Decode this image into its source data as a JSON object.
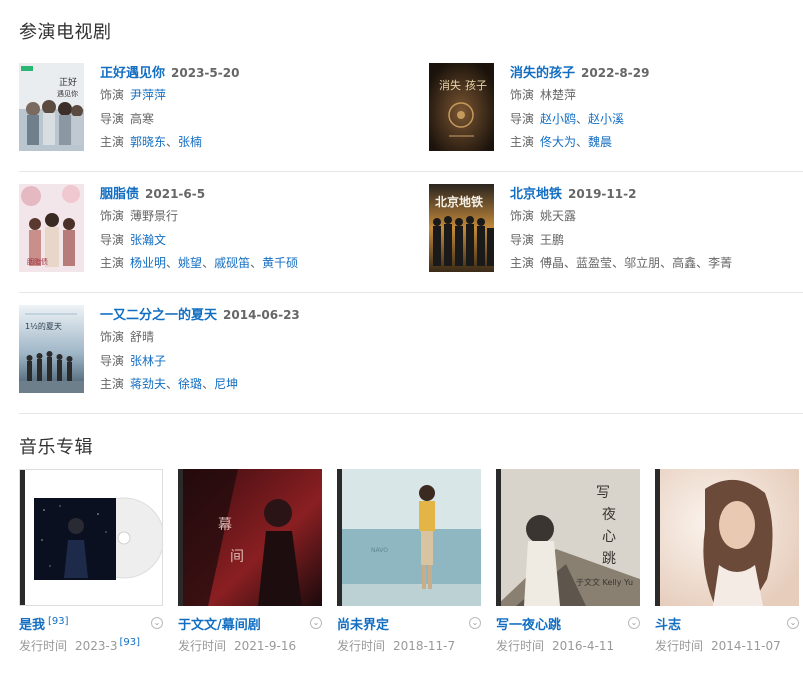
{
  "sections": {
    "tv_title": "参演电视剧",
    "music_title": "音乐专辑"
  },
  "labels": {
    "role": "饰演",
    "director": "导演",
    "starring": "主演",
    "release": "发行时间"
  },
  "dramas": [
    {
      "title": "正好遇见你",
      "date": "2023-5-20",
      "role": "尹萍萍",
      "director": [
        "高寒"
      ],
      "director_linked": [
        false
      ],
      "stars": [
        "郭晓东",
        "张楠"
      ],
      "stars_linked": [
        true,
        true
      ],
      "poster_text": "正好遇见你",
      "poster_colors": [
        "#e9edf0",
        "#b9c6cf",
        "#6f7f8c"
      ]
    },
    {
      "title": "消失的孩子",
      "date": "2022-8-29",
      "role": "林楚萍",
      "director": [
        "赵小鸥",
        "赵小溪"
      ],
      "director_linked": [
        true,
        true
      ],
      "stars": [
        "佟大为",
        "魏晨"
      ],
      "stars_linked": [
        true,
        true
      ],
      "poster_text": "消失的孩子",
      "poster_colors": [
        "#2a1d12",
        "#4a3320",
        "#1a120b"
      ]
    },
    {
      "title": "胭脂债",
      "date": "2021-6-5",
      "role": "薄野景行",
      "director": [
        "张瀚文"
      ],
      "director_linked": [
        true
      ],
      "stars": [
        "杨业明",
        "姚望",
        "戚砚笛",
        "黄千硕"
      ],
      "stars_linked": [
        true,
        true,
        true,
        true
      ],
      "poster_text": "胭脂债",
      "poster_colors": [
        "#f3e6ea",
        "#e4b9c2",
        "#c98f8a"
      ]
    },
    {
      "title": "北京地铁",
      "date": "2019-11-2",
      "role": "姚天露",
      "director": [
        "王鹏"
      ],
      "director_linked": [
        false
      ],
      "stars": [
        "傅晶",
        "蓝盈莹",
        "邬立朋",
        "高鑫",
        "李菁"
      ],
      "stars_linked": [
        false,
        true,
        true,
        true,
        true
      ],
      "poster_text": "北京地铁",
      "poster_colors": [
        "#3a2a18",
        "#c48a3a",
        "#1a1a1a"
      ]
    },
    {
      "title": "一又二分之一的夏天",
      "date": "2014-06-23",
      "role": "舒晴",
      "director": [
        "张林子"
      ],
      "director_linked": [
        true
      ],
      "stars": [
        "蒋劲夫",
        "徐璐",
        "尼坤"
      ],
      "stars_linked": [
        true,
        true,
        true
      ],
      "poster_text": "1½的夏天",
      "poster_colors": [
        "#dfe8ee",
        "#9fb6c7",
        "#3d5566"
      ]
    }
  ],
  "albums": [
    {
      "name": "是我",
      "name_ref": "[93]",
      "date": "2023-3",
      "date_ref": "[93]",
      "cover_colors": [
        "#0b1020",
        "#1d2a4a",
        "#f2f2f2"
      ]
    },
    {
      "name": "于文文/幕间剧",
      "name_ref": "",
      "date": "2021-9-16",
      "date_ref": "",
      "cover_colors": [
        "#1a0a0c",
        "#7a1f22",
        "#b5302f"
      ]
    },
    {
      "name": "尚未界定",
      "name_ref": "",
      "date": "2018-11-7",
      "date_ref": "",
      "cover_colors": [
        "#8fb7c1",
        "#c9dde0",
        "#e3b546"
      ]
    },
    {
      "name": "写一夜心跳",
      "name_ref": "",
      "date": "2016-4-11",
      "date_ref": "",
      "cover_colors": [
        "#d9d4cb",
        "#8a8072",
        "#3a3530"
      ]
    },
    {
      "name": "斗志",
      "name_ref": "",
      "date": "2014-11-07",
      "date_ref": "",
      "cover_colors": [
        "#f2e7de",
        "#d9b7a0",
        "#6b4a3a"
      ]
    }
  ],
  "colors": {
    "link": "#136ec2",
    "text_gray": "#666666",
    "divider": "#e6e6e6"
  }
}
